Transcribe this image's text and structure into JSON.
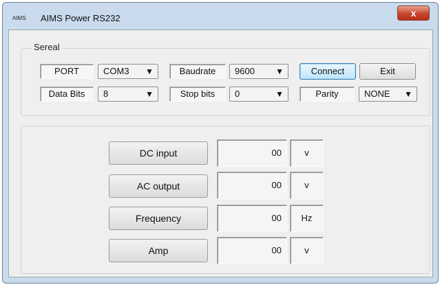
{
  "window": {
    "icon_text": "AIMS",
    "title": "AIMS Power RS232",
    "close_symbol": "x"
  },
  "sereal": {
    "group_label": "Sereal",
    "port_label": "PORT",
    "port_value": "COM3",
    "baudrate_label": "Baudrate",
    "baudrate_value": "9600",
    "connect_label": "Connect",
    "exit_label": "Exit",
    "data_bits_label": "Data Bits",
    "data_bits_value": "8",
    "stop_bits_label": "Stop bits",
    "stop_bits_value": "0",
    "parity_label": "Parity",
    "parity_value": "NONE",
    "dropdown_arrow": "▼"
  },
  "readings": [
    {
      "label": "DC input",
      "value": "00",
      "unit": "v"
    },
    {
      "label": "AC output",
      "value": "00",
      "unit": "v"
    },
    {
      "label": "Frequency",
      "value": "00",
      "unit": "Hz"
    },
    {
      "label": "Amp",
      "value": "00",
      "unit": "v"
    }
  ]
}
